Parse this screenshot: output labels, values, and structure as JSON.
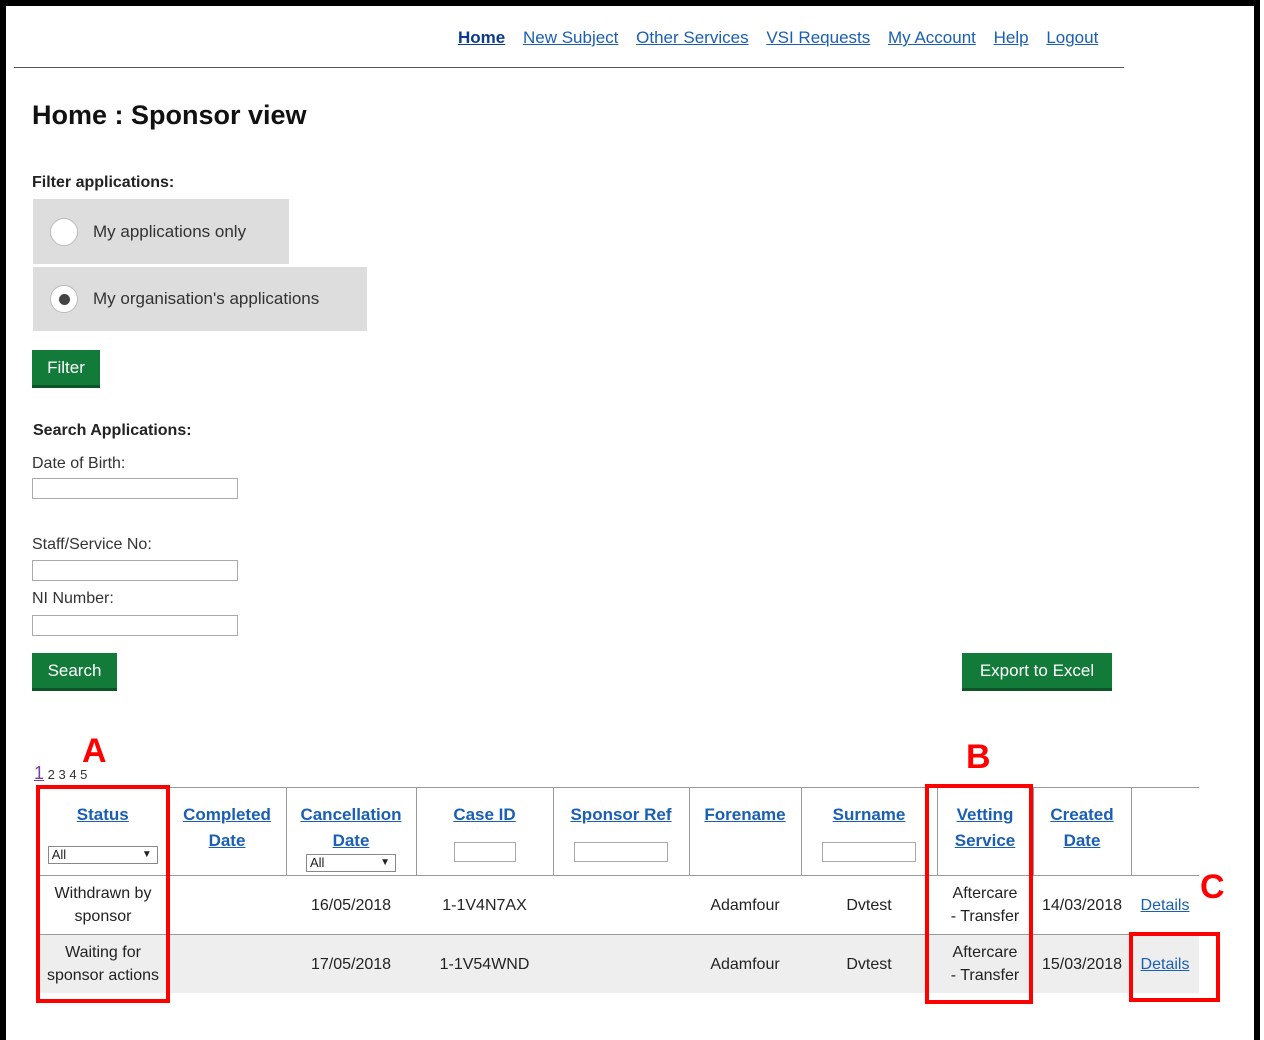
{
  "nav": [
    "Home",
    "New Subject",
    "Other Services",
    "VSI Requests",
    "My Account",
    "Help",
    "Logout"
  ],
  "page_title": "Home : Sponsor view",
  "filter": {
    "label": "Filter applications:",
    "option_mine": "My applications only",
    "option_org": "My organisation's applications",
    "button": "Filter"
  },
  "search": {
    "label": "Search Applications:",
    "dob": "Date of Birth:",
    "staff": "Staff/Service No:",
    "ni": "NI Number:",
    "button": "Search",
    "export": "Export to Excel"
  },
  "pager": {
    "current": "1",
    "others": "2 3 4 5"
  },
  "columns": {
    "status": "Status",
    "completed": [
      "Completed",
      "Date"
    ],
    "cancellation": [
      "Cancellation",
      "Date"
    ],
    "caseid": "Case ID",
    "sponsorref": "Sponsor Ref",
    "forename": "Forename",
    "surname": "Surname",
    "vetting": [
      "Vetting",
      "Service"
    ],
    "created": [
      "Created",
      "Date"
    ],
    "status_filter": "All",
    "cancel_filter": "All"
  },
  "rows": [
    {
      "status": [
        "Withdrawn by",
        "sponsor"
      ],
      "completed": "",
      "cancellation": "16/05/2018",
      "caseid": "1-1V4N7AX",
      "sponsorref": "",
      "forename": "Adamfour",
      "surname": "Dvtest",
      "vetting": [
        "Aftercare",
        "- Transfer"
      ],
      "created": "14/03/2018",
      "details": "Details"
    },
    {
      "status": [
        "Waiting for",
        "sponsor actions"
      ],
      "completed": "",
      "cancellation": "17/05/2018",
      "caseid": "1-1V54WND",
      "sponsorref": "",
      "forename": "Adamfour",
      "surname": "Dvtest",
      "vetting": [
        "Aftercare",
        "- Transfer"
      ],
      "created": "15/03/2018",
      "details": "Details"
    }
  ],
  "annotations": [
    "A",
    "B",
    "C"
  ],
  "colors": {
    "button": "#137b3a",
    "link": "#1a5fb4",
    "annotation": "#ff0000"
  }
}
